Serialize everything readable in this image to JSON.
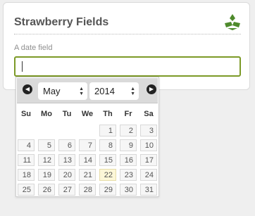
{
  "card": {
    "title": "Strawberry Fields",
    "field_label": "A date field",
    "input_value": "",
    "logo_icon": "strawberry-leaf-logo-icon"
  },
  "datepicker": {
    "prev_icon": "chevron-left-icon",
    "next_icon": "chevron-right-icon",
    "month": "May",
    "year": "2014",
    "weekdays": [
      "Su",
      "Mo",
      "Tu",
      "We",
      "Th",
      "Fr",
      "Sa"
    ],
    "weeks": [
      [
        null,
        null,
        null,
        null,
        1,
        2,
        3
      ],
      [
        4,
        5,
        6,
        7,
        8,
        9,
        10
      ],
      [
        11,
        12,
        13,
        14,
        15,
        16,
        17
      ],
      [
        18,
        19,
        20,
        21,
        22,
        23,
        24
      ],
      [
        25,
        26,
        27,
        28,
        29,
        30,
        31
      ]
    ],
    "today": 22,
    "colors": {
      "header_bg": "#dadada",
      "input_border": "#7c9a27",
      "logo_green": "#4e8a2c",
      "today_bg": "#fcf7d8"
    }
  }
}
